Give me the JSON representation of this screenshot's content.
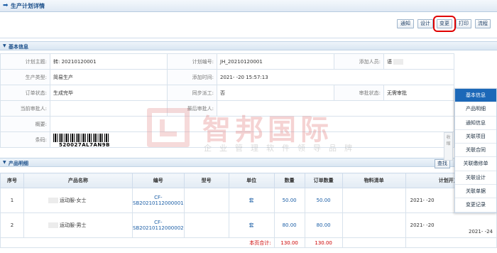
{
  "page": {
    "title": "生产计划详情"
  },
  "toolbar": {
    "buttons": [
      "通知",
      "设计",
      "变更",
      "打印",
      "流程"
    ]
  },
  "basic": {
    "section": "基本信息",
    "plan_subject_label": "计划主题:",
    "plan_subject": "转: 20210120001",
    "plan_no_label": "计划编号:",
    "plan_no": "JH_20210120001",
    "adder_label": "添加人员:",
    "adder": "语",
    "prod_type_label": "生产类型:",
    "prod_type": "简易生产",
    "add_time_label": "添加时间:",
    "add_time": "2021-  -20 15:57:13",
    "order_status_label": "订单状态:",
    "order_status": "生成完毕",
    "sync_label": "同步派工:",
    "sync": "否",
    "approval_status_label": "审批状态:",
    "approval_status": "无需审批",
    "cur_approver_label": "当前审批人:",
    "last_approver_label": "最后审批人:",
    "summary_label": "概要:",
    "barcode_label": "条码:",
    "barcode_text": "520027AL7AN9B"
  },
  "products": {
    "section": "产品明细",
    "search_btn": "查找",
    "headers": [
      "序号",
      "产品名称",
      "编号",
      "型号",
      "单位",
      "数量",
      "订单数量",
      "物料清单",
      "计划开工期"
    ],
    "rows": [
      {
        "idx": "1",
        "name": "运动服-女士",
        "code_a": "CF-",
        "code_b": "SB20210112000001",
        "model": "",
        "unit": "套",
        "qty": "50.00",
        "order_qty": "50.00",
        "bom": "",
        "start": "2021-  -20"
      },
      {
        "idx": "2",
        "name": "运动服-男士",
        "code_a": "CF-",
        "code_b": "SB20210112000002",
        "model": "",
        "unit": "套",
        "qty": "80.00",
        "order_qty": "80.00",
        "bom": "",
        "start": "2021-  -20"
      }
    ],
    "total_label": "本页合计:",
    "total_qty": "130.00",
    "total_order_qty": "130.00"
  },
  "side_nav": [
    "基本信息",
    "产品明细",
    "通知信息",
    "关联项目",
    "关联合同",
    "关联缴修单",
    "关联设计",
    "关联单据",
    "变更记录"
  ],
  "side_extra_date": "2021-  -24",
  "collapse_label": "收缩",
  "watermark": {
    "main": "智邦国际",
    "sub": "企业管理软件领导品牌"
  }
}
